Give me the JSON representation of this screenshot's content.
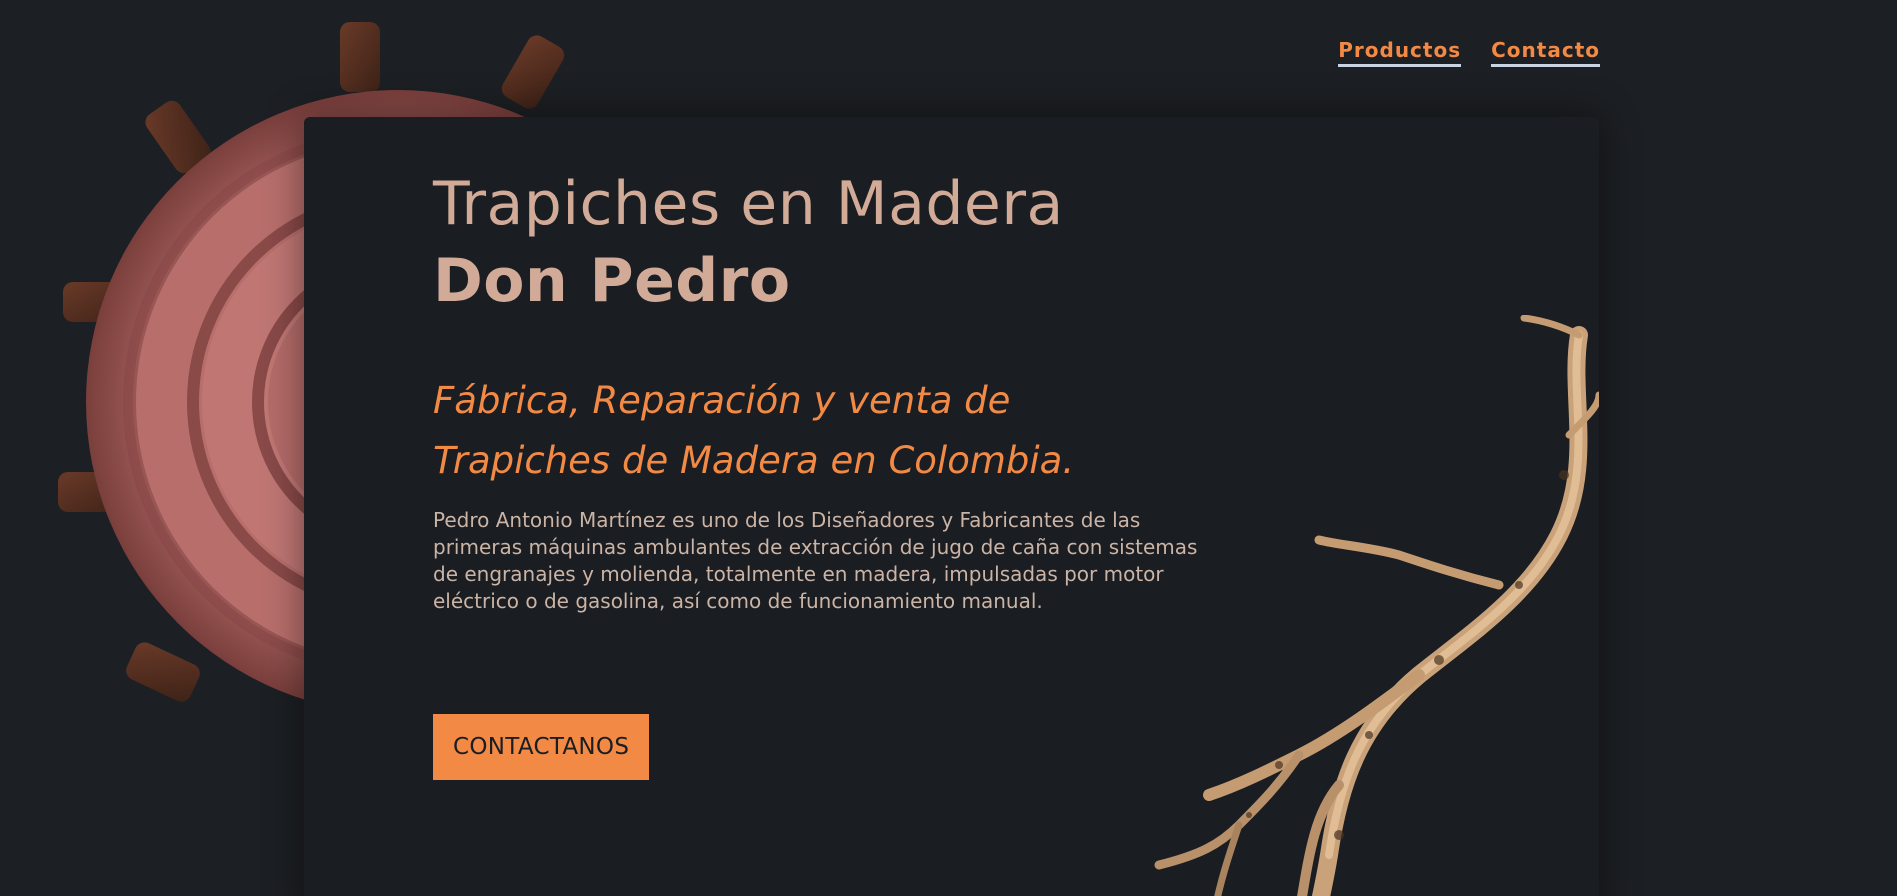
{
  "nav": {
    "items": [
      {
        "label": "Productos"
      },
      {
        "label": "Contacto"
      }
    ]
  },
  "hero": {
    "title_line1": "Trapiches en Madera",
    "title_line2": "Don Pedro",
    "subtitle_line1": "Fábrica, Reparación y venta de",
    "subtitle_line2": "Trapiches de Madera en Colombia.",
    "description": "Pedro Antonio Martínez es uno de los Diseñadores y Fabricantes de las primeras máquinas ambulantes de extracción de jugo de caña con sistemas de engranajes y molienda, totalmente en madera, impulsadas por motor eléctrico o de gasolina, así como de funcionamiento manual.",
    "cta_label": "CONTACTANOS"
  },
  "colors": {
    "background": "#1c1f23",
    "card": "#1a1d21",
    "accent": "#f28a45",
    "title": "#d1ab98",
    "text": "#cbb4a5",
    "nav_underline": "#c9d4e2"
  },
  "icons": {
    "gear": "wooden-gear-image",
    "branch": "dried-branch-image"
  }
}
